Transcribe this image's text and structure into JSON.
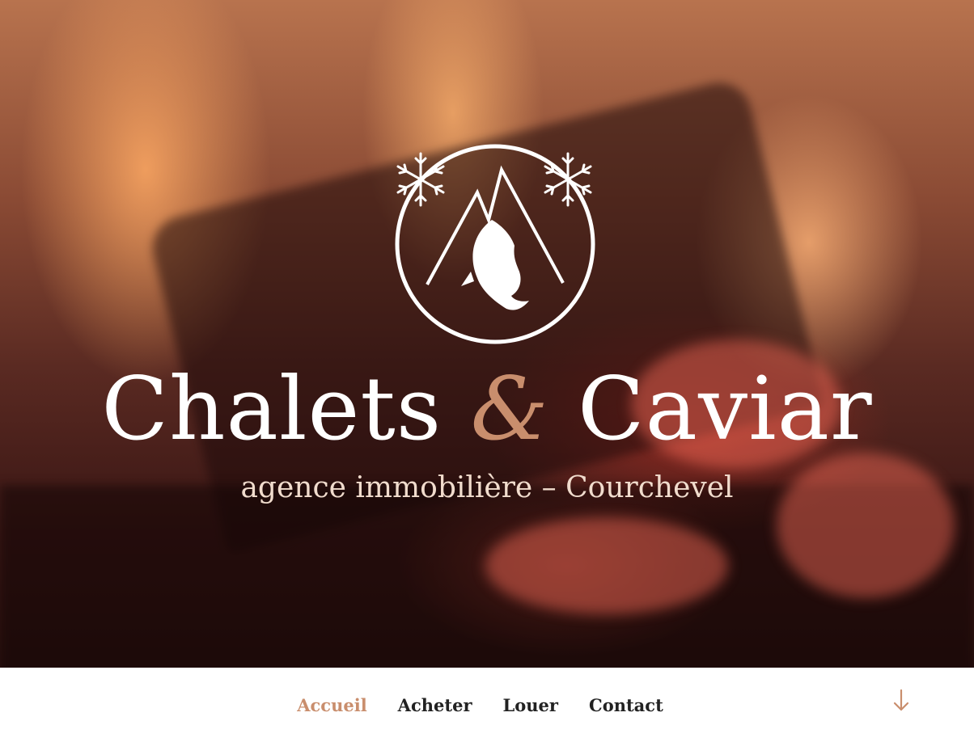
{
  "brand": {
    "title_part1": "Chalets",
    "ampersand": "&",
    "title_part2": "Caviar",
    "subtitle": "agence immobilière – Courchevel",
    "logo_icon": "mountain-fish-snowflake-logo",
    "accent_color": "#c98e6d"
  },
  "nav": {
    "items": [
      {
        "label": "Accueil",
        "active": true
      },
      {
        "label": "Acheter",
        "active": false
      },
      {
        "label": "Louer",
        "active": false
      },
      {
        "label": "Contact",
        "active": false
      }
    ],
    "scroll_icon": "arrow-down-icon"
  }
}
